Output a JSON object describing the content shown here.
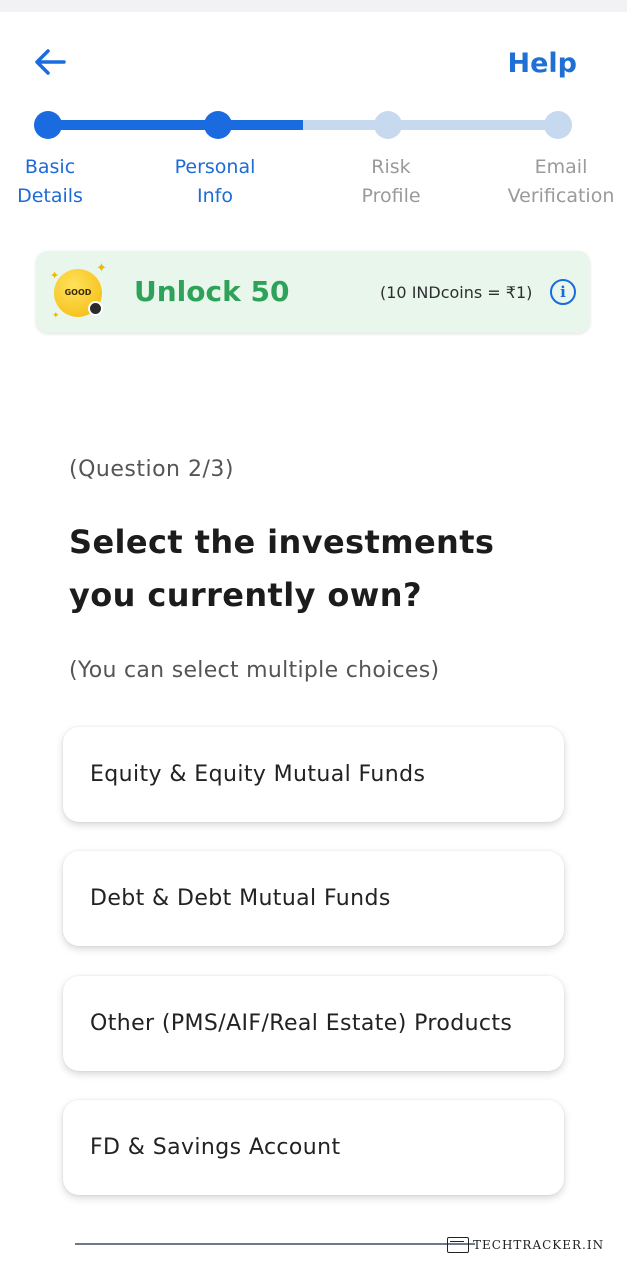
{
  "header": {
    "back_icon": "arrow-left-icon",
    "help_label": "Help"
  },
  "stepper": {
    "steps": [
      {
        "line1": "Basic",
        "line2": "Details",
        "state": "done"
      },
      {
        "line1": "Personal",
        "line2": "Info",
        "state": "current"
      },
      {
        "line1": "Risk",
        "line2": "Profile",
        "state": "todo"
      },
      {
        "line1": "Email",
        "line2": "Verification",
        "state": "todo"
      }
    ],
    "current_segment_progress": 0.5
  },
  "reward": {
    "coin_text": "GOOD",
    "unlock_text": "Unlock 50",
    "rate_text": "(10 INDcoins = ₹1)",
    "info_icon": "info-icon"
  },
  "question": {
    "count": "(Question 2/3)",
    "title": "Select the investments you currently own?",
    "hint": "(You can select multiple choices)"
  },
  "options": [
    "Equity & Equity Mutual Funds",
    "Debt & Debt Mutual Funds",
    "Other (PMS/AIF/Real Estate) Products",
    "FD & Savings Account"
  ],
  "watermark": "TECHTRACKER.IN",
  "colors": {
    "accent": "#1a6be0",
    "step_inactive": "#c7d9ee",
    "reward_bg": "#e8f6ec",
    "reward_text": "#2fa25a"
  }
}
